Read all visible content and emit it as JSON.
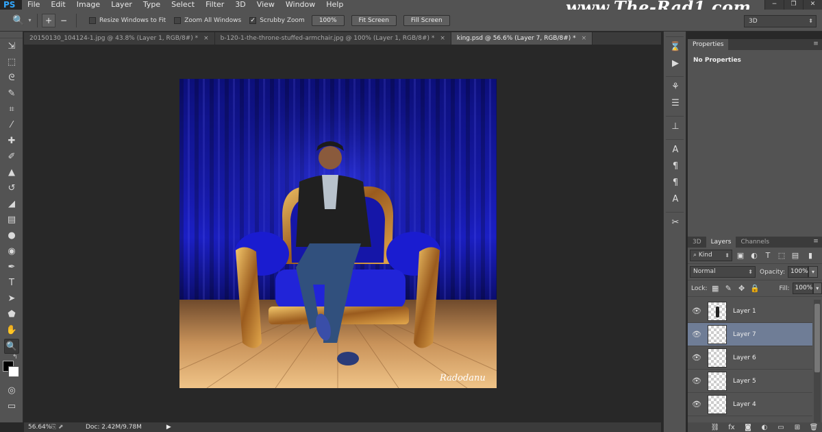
{
  "app": {
    "logo": "PS"
  },
  "menu": [
    "File",
    "Edit",
    "Image",
    "Layer",
    "Type",
    "Select",
    "Filter",
    "3D",
    "View",
    "Window",
    "Help"
  ],
  "watermark": "www.The-Rad1.com",
  "window_buttons": [
    "−",
    "❐",
    "✕"
  ],
  "options": {
    "tool_icon": "zoom-tool-icon",
    "zoom_in": "+",
    "zoom_out": "−",
    "resize_windows": "Resize Windows to Fit",
    "resize_checked": false,
    "zoom_all": "Zoom All Windows",
    "zoom_all_checked": false,
    "scrubby_zoom": "Scrubby Zoom",
    "scrubby_checked": true,
    "btn_100": "100%",
    "btn_fit": "Fit Screen",
    "btn_fill": "Fill Screen",
    "workspace": "3D"
  },
  "tabs": [
    {
      "label": "20150130_104124-1.jpg @ 43.8% (Layer 1, RGB/8#) *",
      "active": false
    },
    {
      "label": "b-120-1-the-throne-stuffed-armchair.jpg @ 100% (Layer 1, RGB/8#) *",
      "active": false
    },
    {
      "label": "king.psd @ 56.6% (Layer 7, RGB/8#) *",
      "active": true
    }
  ],
  "tools": [
    "move-tool-icon",
    "marquee-tool-icon",
    "lasso-tool-icon",
    "quick-select-tool-icon",
    "crop-tool-icon",
    "eyedropper-tool-icon",
    "healing-tool-icon",
    "brush-tool-icon",
    "stamp-tool-icon",
    "history-brush-tool-icon",
    "eraser-tool-icon",
    "gradient-tool-icon",
    "blur-tool-icon",
    "dodge-tool-icon",
    "pen-tool-icon",
    "type-tool-icon",
    "path-select-tool-icon",
    "shape-tool-icon",
    "hand-tool-icon",
    "zoom-tool-icon"
  ],
  "tool_glyphs": [
    "⇲",
    "⬚",
    "ᘓ",
    "✎",
    "⌗",
    "⁄",
    "✚",
    "✐",
    "▲",
    "↺",
    "◢",
    "▤",
    "●",
    "◉",
    "✒",
    "T",
    "➤",
    "⬟",
    "✋",
    "🔍"
  ],
  "status": {
    "zoom": "56.64%",
    "doc": "Doc: 2.42M/9.78M",
    "arrow": "▶"
  },
  "properties": {
    "tab": "Properties",
    "content": "No Properties"
  },
  "layers_panel": {
    "tabs": [
      "3D",
      "Layers",
      "Channels"
    ],
    "kind": "Kind",
    "blend": "Normal",
    "opacity_label": "Opacity:",
    "opacity": "100%",
    "lock_label": "Lock:",
    "fill_label": "Fill:",
    "fill": "100%",
    "layers": [
      {
        "name": "Layer 1",
        "selected": false
      },
      {
        "name": "Layer 7",
        "selected": true
      },
      {
        "name": "Layer 6",
        "selected": false
      },
      {
        "name": "Layer 5",
        "selected": false
      },
      {
        "name": "Layer 4",
        "selected": false
      }
    ]
  },
  "artwork": {
    "signature": "Radodanu"
  },
  "colors": {
    "accent": "#31a8ff",
    "panel": "#535353",
    "workspace": "#282828",
    "selected_layer": "#6f7d96"
  }
}
